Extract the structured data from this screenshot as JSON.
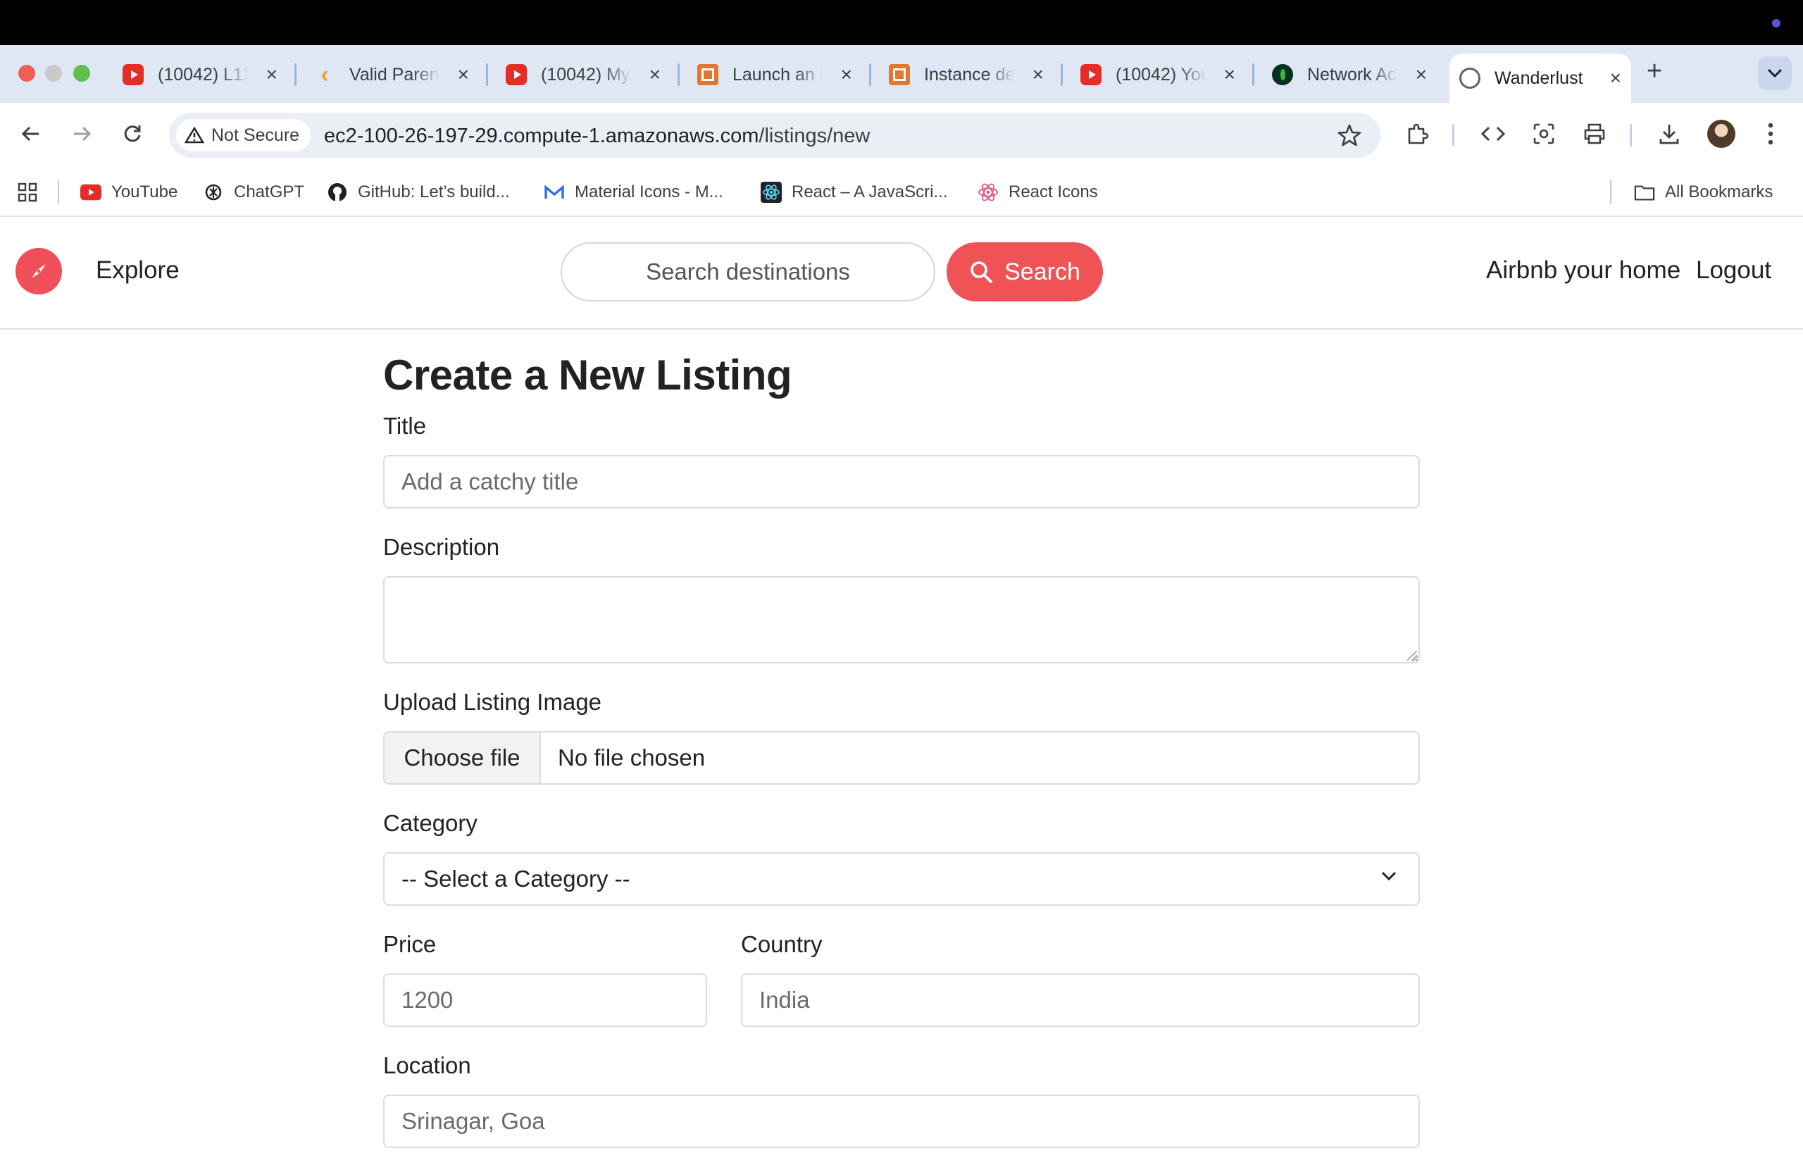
{
  "browser": {
    "tabs": [
      {
        "title": "(10042) L11",
        "favicon": "youtube-icon"
      },
      {
        "title": "Valid Parenthesis",
        "favicon": "leetcode-icon"
      },
      {
        "title": "(10042) My",
        "favicon": "youtube-icon"
      },
      {
        "title": "Launch an instance",
        "favicon": "aws-icon"
      },
      {
        "title": "Instance details",
        "favicon": "aws-icon"
      },
      {
        "title": "(10042) You",
        "favicon": "youtube-icon"
      },
      {
        "title": "Network Access",
        "favicon": "mongodb-icon"
      },
      {
        "title": "Wanderlust",
        "favicon": "globe-icon",
        "active": true
      }
    ],
    "security_chip": "Not Secure",
    "url_host": "ec2-100-26-197-29.compute-1.amazonaws.com",
    "url_path": "/listings/new",
    "bookmarks": [
      {
        "label": "YouTube",
        "icon": "youtube-icon"
      },
      {
        "label": "ChatGPT",
        "icon": "chatgpt-icon"
      },
      {
        "label": "GitHub: Let’s build...",
        "icon": "github-icon"
      },
      {
        "label": "Material Icons - M...",
        "icon": "material-icons-icon"
      },
      {
        "label": "React – A JavaScri...",
        "icon": "react-icon"
      },
      {
        "label": "React Icons",
        "icon": "react-icons-icon"
      }
    ],
    "all_bookmarks": "All Bookmarks"
  },
  "site": {
    "explore": "Explore",
    "search_placeholder": "Search destinations",
    "search_button": "Search",
    "airbnb_link": "Airbnb your home",
    "logout_link": "Logout",
    "brand_color": "#ef5356"
  },
  "form": {
    "heading": "Create a New Listing",
    "title_label": "Title",
    "title_placeholder": "Add a catchy title",
    "description_label": "Description",
    "image_label": "Upload Listing Image",
    "choose_file": "Choose file",
    "no_file": "No file chosen",
    "category_label": "Category",
    "category_selected": "-- Select a Category --",
    "price_label": "Price",
    "price_placeholder": "1200",
    "country_label": "Country",
    "country_placeholder": "India",
    "location_label": "Location",
    "location_placeholder": "Srinagar, Goa"
  }
}
